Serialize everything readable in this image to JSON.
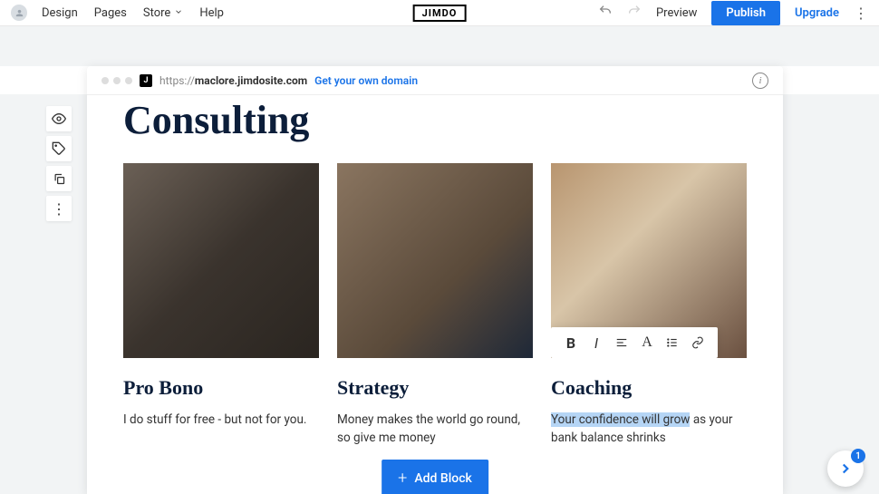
{
  "topbar": {
    "nav": [
      "Design",
      "Pages",
      "Store",
      "Help"
    ],
    "logo": "JIMDO",
    "preview": "Preview",
    "publish": "Publish",
    "upgrade": "Upgrade"
  },
  "addressbar": {
    "prefix": "https://",
    "domain": "maclore.jimdosite.com",
    "cta": "Get your own domain"
  },
  "page": {
    "title": "Consulting",
    "cols": [
      {
        "heading": "Pro Bono",
        "body": "I do stuff for free - but not for you."
      },
      {
        "heading": "Strategy",
        "body": "Money makes the world go round, so give me money"
      },
      {
        "heading": "Coaching",
        "body_pre": "Your confidence will grow",
        "body_post": " as your bank balance shrinks"
      }
    ],
    "addblock": "Add Block"
  },
  "help_badge": "1"
}
